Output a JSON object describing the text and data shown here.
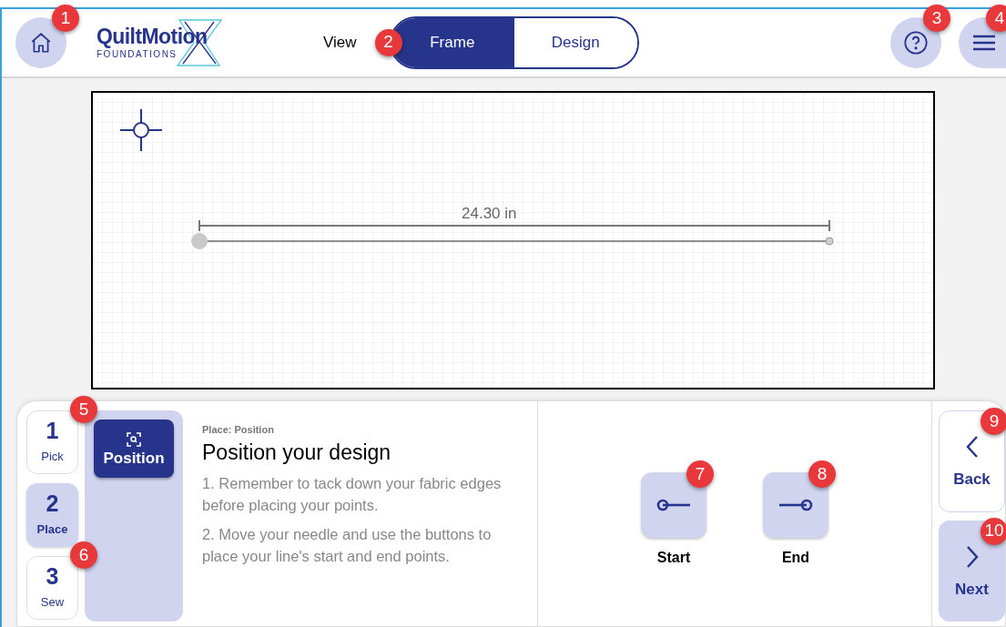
{
  "header": {
    "home": {
      "callout": "1"
    },
    "logo": {
      "name": "QuiltMotion",
      "subtitle": "FOUNDATIONS"
    },
    "view_switch": {
      "label": "View",
      "callout": "2",
      "tabs": [
        {
          "label": "Frame",
          "selected": true
        },
        {
          "label": "Design",
          "selected": false
        }
      ]
    },
    "help": {
      "callout": "3"
    },
    "menu": {
      "callout": "4"
    }
  },
  "canvas": {
    "measurement": "24.30 in"
  },
  "steps": [
    {
      "number": "1",
      "label": "Pick",
      "selected": false,
      "callout": "5"
    },
    {
      "number": "2",
      "label": "Place",
      "selected": true
    },
    {
      "number": "3",
      "label": "Sew",
      "selected": false,
      "callout": "6"
    }
  ],
  "substeps": [
    {
      "label": "Position",
      "selected": true
    }
  ],
  "instructions": {
    "breadcrumb": "Place: Position",
    "title": "Position your design",
    "paragraphs": [
      "1. Remember to tack down your fabric edges before placing your points.",
      "2. Move your needle and use the buttons to place your line's start and end points."
    ]
  },
  "actions": [
    {
      "kind": "start",
      "label": "Start",
      "callout": "7"
    },
    {
      "kind": "end",
      "label": "End",
      "callout": "8"
    }
  ],
  "nav": [
    {
      "kind": "back",
      "label": "Back",
      "callout": "9"
    },
    {
      "kind": "next",
      "label": "Next",
      "callout": "10"
    }
  ]
}
